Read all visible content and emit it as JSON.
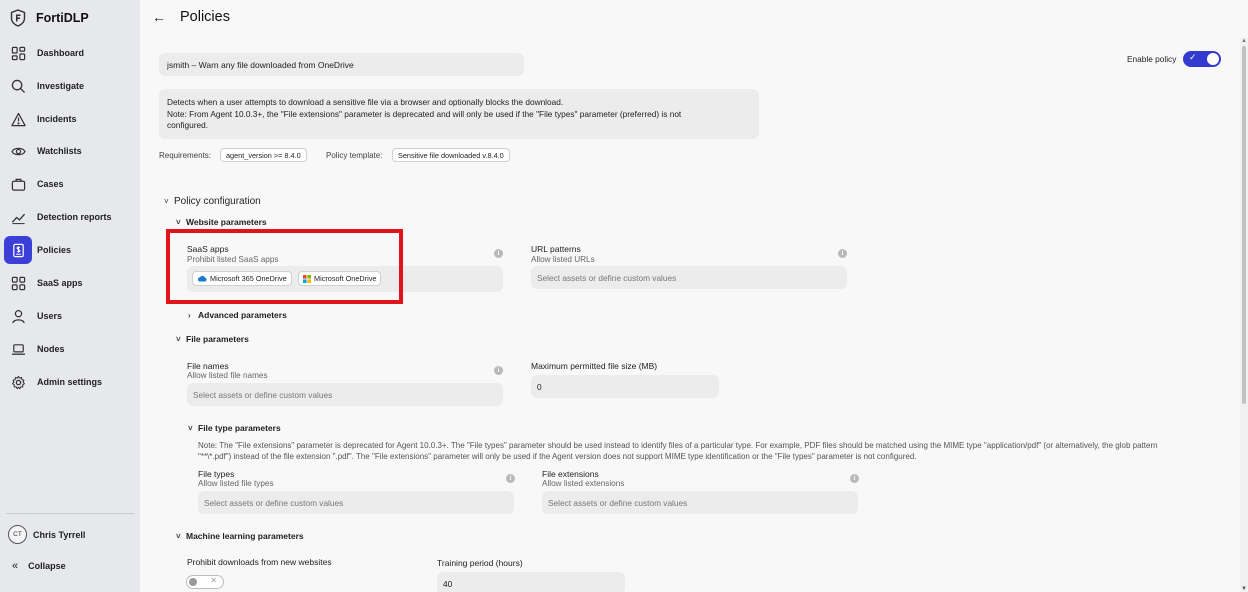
{
  "app": {
    "name": "FortiDLP"
  },
  "sidebar": {
    "items": [
      {
        "label": "Dashboard",
        "icon": "dashboard-icon"
      },
      {
        "label": "Investigate",
        "icon": "search-icon"
      },
      {
        "label": "Incidents",
        "icon": "warning-icon"
      },
      {
        "label": "Watchlists",
        "icon": "eye-icon"
      },
      {
        "label": "Cases",
        "icon": "briefcase-icon"
      },
      {
        "label": "Detection reports",
        "icon": "trend-icon"
      },
      {
        "label": "Policies",
        "icon": "policy-icon",
        "active": true
      },
      {
        "label": "SaaS apps",
        "icon": "apps-icon"
      },
      {
        "label": "Users",
        "icon": "user-icon"
      },
      {
        "label": "Nodes",
        "icon": "laptop-icon"
      },
      {
        "label": "Admin settings",
        "icon": "gear-icon"
      }
    ],
    "user": {
      "initials": "CT",
      "name": "Chris Tyrrell"
    },
    "collapse_label": "Collapse"
  },
  "header": {
    "title": "Policies"
  },
  "policy": {
    "name": "jsmith – Warn any file downloaded from OneDrive",
    "description_lines": [
      "Detects when a user attempts to download a sensitive file via a browser and optionally blocks the download.",
      "Note: From Agent 10.0.3+, the \"File extensions\" parameter is deprecated and will only be used if the \"File types\" parameter (preferred) is not",
      "configured."
    ],
    "requirements_label": "Requirements:",
    "requirements_value": "agent_version >= 8.4.0",
    "template_label": "Policy template:",
    "template_value": "Sensitive file downloaded v.8.4.0",
    "enable_label": "Enable policy",
    "enabled": true
  },
  "config": {
    "title": "Policy configuration",
    "website": {
      "title": "Website parameters",
      "saas": {
        "label": "SaaS apps",
        "sublabel": "Prohibit listed SaaS apps",
        "chips": [
          "Microsoft 365 OneDrive",
          "Microsoft OneDrive"
        ]
      },
      "url": {
        "label": "URL patterns",
        "sublabel": "Allow listed URLs",
        "placeholder": "Select assets or define custom values"
      },
      "advanced": "Advanced parameters"
    },
    "file": {
      "title": "File parameters",
      "names": {
        "label": "File names",
        "sublabel": "Allow listed file names",
        "placeholder": "Select assets or define custom values"
      },
      "max_size": {
        "label": "Maximum permitted file size (MB)",
        "value": "0"
      },
      "type_params": {
        "title": "File type parameters",
        "note_lines": [
          "Note: The \"File extensions\" parameter is deprecated for Agent 10.0.3+. The \"File types\" parameter should be used instead to identify files of a particular type. For example, PDF files should be matched using the MIME type \"application/pdf\" (or alternatively, the glob pattern",
          "\"**\\*.pdf\") instead of the file extension \".pdf\". The \"File extensions\" parameter will only be used if the Agent version does not support MIME type identification or the \"File types\" parameter is not configured."
        ],
        "types": {
          "label": "File types",
          "sublabel": "Allow listed file types",
          "placeholder": "Select assets or define custom values"
        },
        "extensions": {
          "label": "File extensions",
          "sublabel": "Allow listed extensions",
          "placeholder": "Select assets or define custom values"
        }
      }
    },
    "ml": {
      "title": "Machine learning parameters",
      "prohibit_label": "Prohibit downloads from new websites",
      "prohibit_enabled": false,
      "training": {
        "label": "Training period (hours)",
        "value": "40"
      }
    }
  },
  "colors": {
    "accent": "#3b3fd8",
    "highlight": "#e2141b"
  }
}
